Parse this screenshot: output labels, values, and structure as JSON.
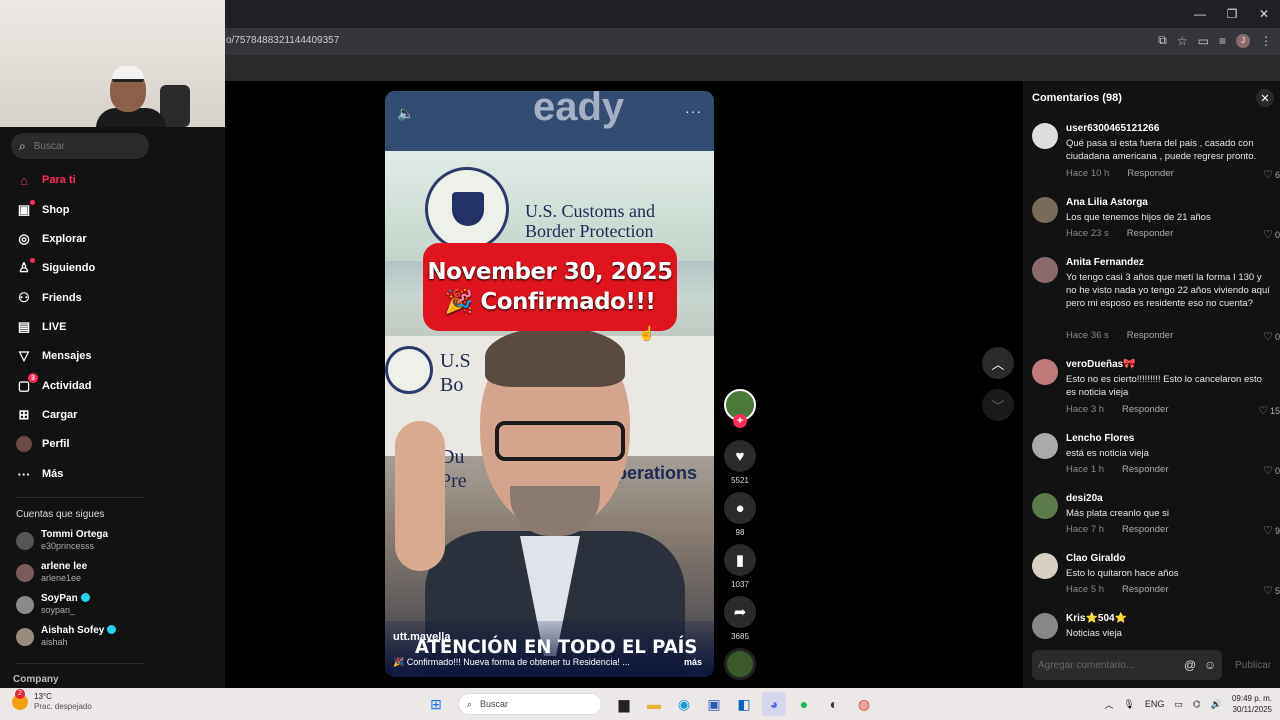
{
  "browser": {
    "url": "o/7578488321144409357",
    "window_controls": [
      "—",
      "❐",
      "✕"
    ]
  },
  "sidebar": {
    "search_placeholder": "Buscar",
    "nav": [
      {
        "label": "Para ti",
        "icon": "home-icon",
        "active": true
      },
      {
        "label": "Shop",
        "icon": "shop-bag-icon"
      },
      {
        "label": "Explorar",
        "icon": "compass-icon"
      },
      {
        "label": "Siguiendo",
        "icon": "person-follow-icon"
      },
      {
        "label": "Friends",
        "icon": "friends-icon"
      },
      {
        "label": "LIVE",
        "icon": "live-tv-icon"
      },
      {
        "label": "Mensajes",
        "icon": "send-message-icon"
      },
      {
        "label": "Actividad",
        "icon": "inbox-activity-icon",
        "badge": "3"
      },
      {
        "label": "Cargar",
        "icon": "upload-plus-icon"
      },
      {
        "label": "Perfil",
        "icon": "profile-avatar-icon"
      },
      {
        "label": "Más",
        "icon": "more-dots-icon"
      }
    ],
    "following_title": "Cuentas que sigues",
    "following": [
      {
        "name": "Tommi Ortega",
        "handle": "e30princesss",
        "verified": false
      },
      {
        "name": "arlene lee",
        "handle": "arlene1ee",
        "verified": false
      },
      {
        "name": "SoyPan",
        "handle": "soypan_",
        "verified": true
      },
      {
        "name": "Aishah Sofey",
        "handle": "aishah",
        "verified": true
      }
    ],
    "company_label": "Company"
  },
  "video": {
    "banner_line1": "November 30, 2025",
    "banner_line2": "🎉 Confirmado!!!",
    "sign_top": "eady",
    "sign_line1": "U.S. Customs and",
    "sign_line2": "Border Protection",
    "sign2_line1": "U.S",
    "sign2_line2": "Bo",
    "sign2_line3": "Du",
    "sign2_line4": "Pre",
    "sign2_right": "operations",
    "author": "utt.mayella",
    "caption_big": "ATENCIÓN EN TODO EL PAÍS",
    "description": "🎉 Confirmado!!! Nueva forma de obtener tu Residencia! ...",
    "more": "más"
  },
  "actions": {
    "likes": "5521",
    "comments": "98",
    "saves": "1037",
    "shares": "3685"
  },
  "comments": {
    "title": "Comentarios (98)",
    "reply_label": "Responder",
    "input_placeholder": "Agregar comentario...",
    "post_label": "Publicar",
    "items": [
      {
        "user": "user6300465121266",
        "text": "Qué pasa si esta fuera del pais , casado con ciudadana americana , puede regresr pronto.",
        "time": "Hace 10 h",
        "likes": "6"
      },
      {
        "user": "Ana Lilia Astorga",
        "text": "Los que tenemos hijos de 21 años",
        "time": "Hace 23 s",
        "likes": "0"
      },
      {
        "user": "Anita Fernandez",
        "text": "Yo tengo casi 3 años que metí la forma I 130 y no he visto nada yo tengo 22 años viviendo aquí pero mi esposo es residente eso no cuenta?",
        "time": "Hace 36 s",
        "likes": "0"
      },
      {
        "user": "veroDueñas🎀",
        "text": "Esto no es cierto!!!!!!!!! Esto lo cancelaron esto es noticia vieja",
        "time": "Hace 3 h",
        "likes": "15"
      },
      {
        "user": "Lencho Flores",
        "text": "está es noticia vieja",
        "time": "Hace 1 h",
        "likes": "0"
      },
      {
        "user": "desi20a",
        "text": "Más plata creanlo que si",
        "time": "Hace 7 h",
        "likes": "9"
      },
      {
        "user": "Clao Giraldo",
        "text": "Esto lo quitaron hace años",
        "time": "Hace 5 h",
        "likes": "5"
      },
      {
        "user": "Kris⭐504⭐",
        "text": "Noticias vieja",
        "time": "",
        "likes": ""
      }
    ]
  },
  "taskbar": {
    "temp": "13°C",
    "weather": "Prac. despejado",
    "weather_badge": "2",
    "search_placeholder": "Buscar",
    "lang": "ENG",
    "time": "09:49 p. m.",
    "date": "30/11/2025"
  }
}
